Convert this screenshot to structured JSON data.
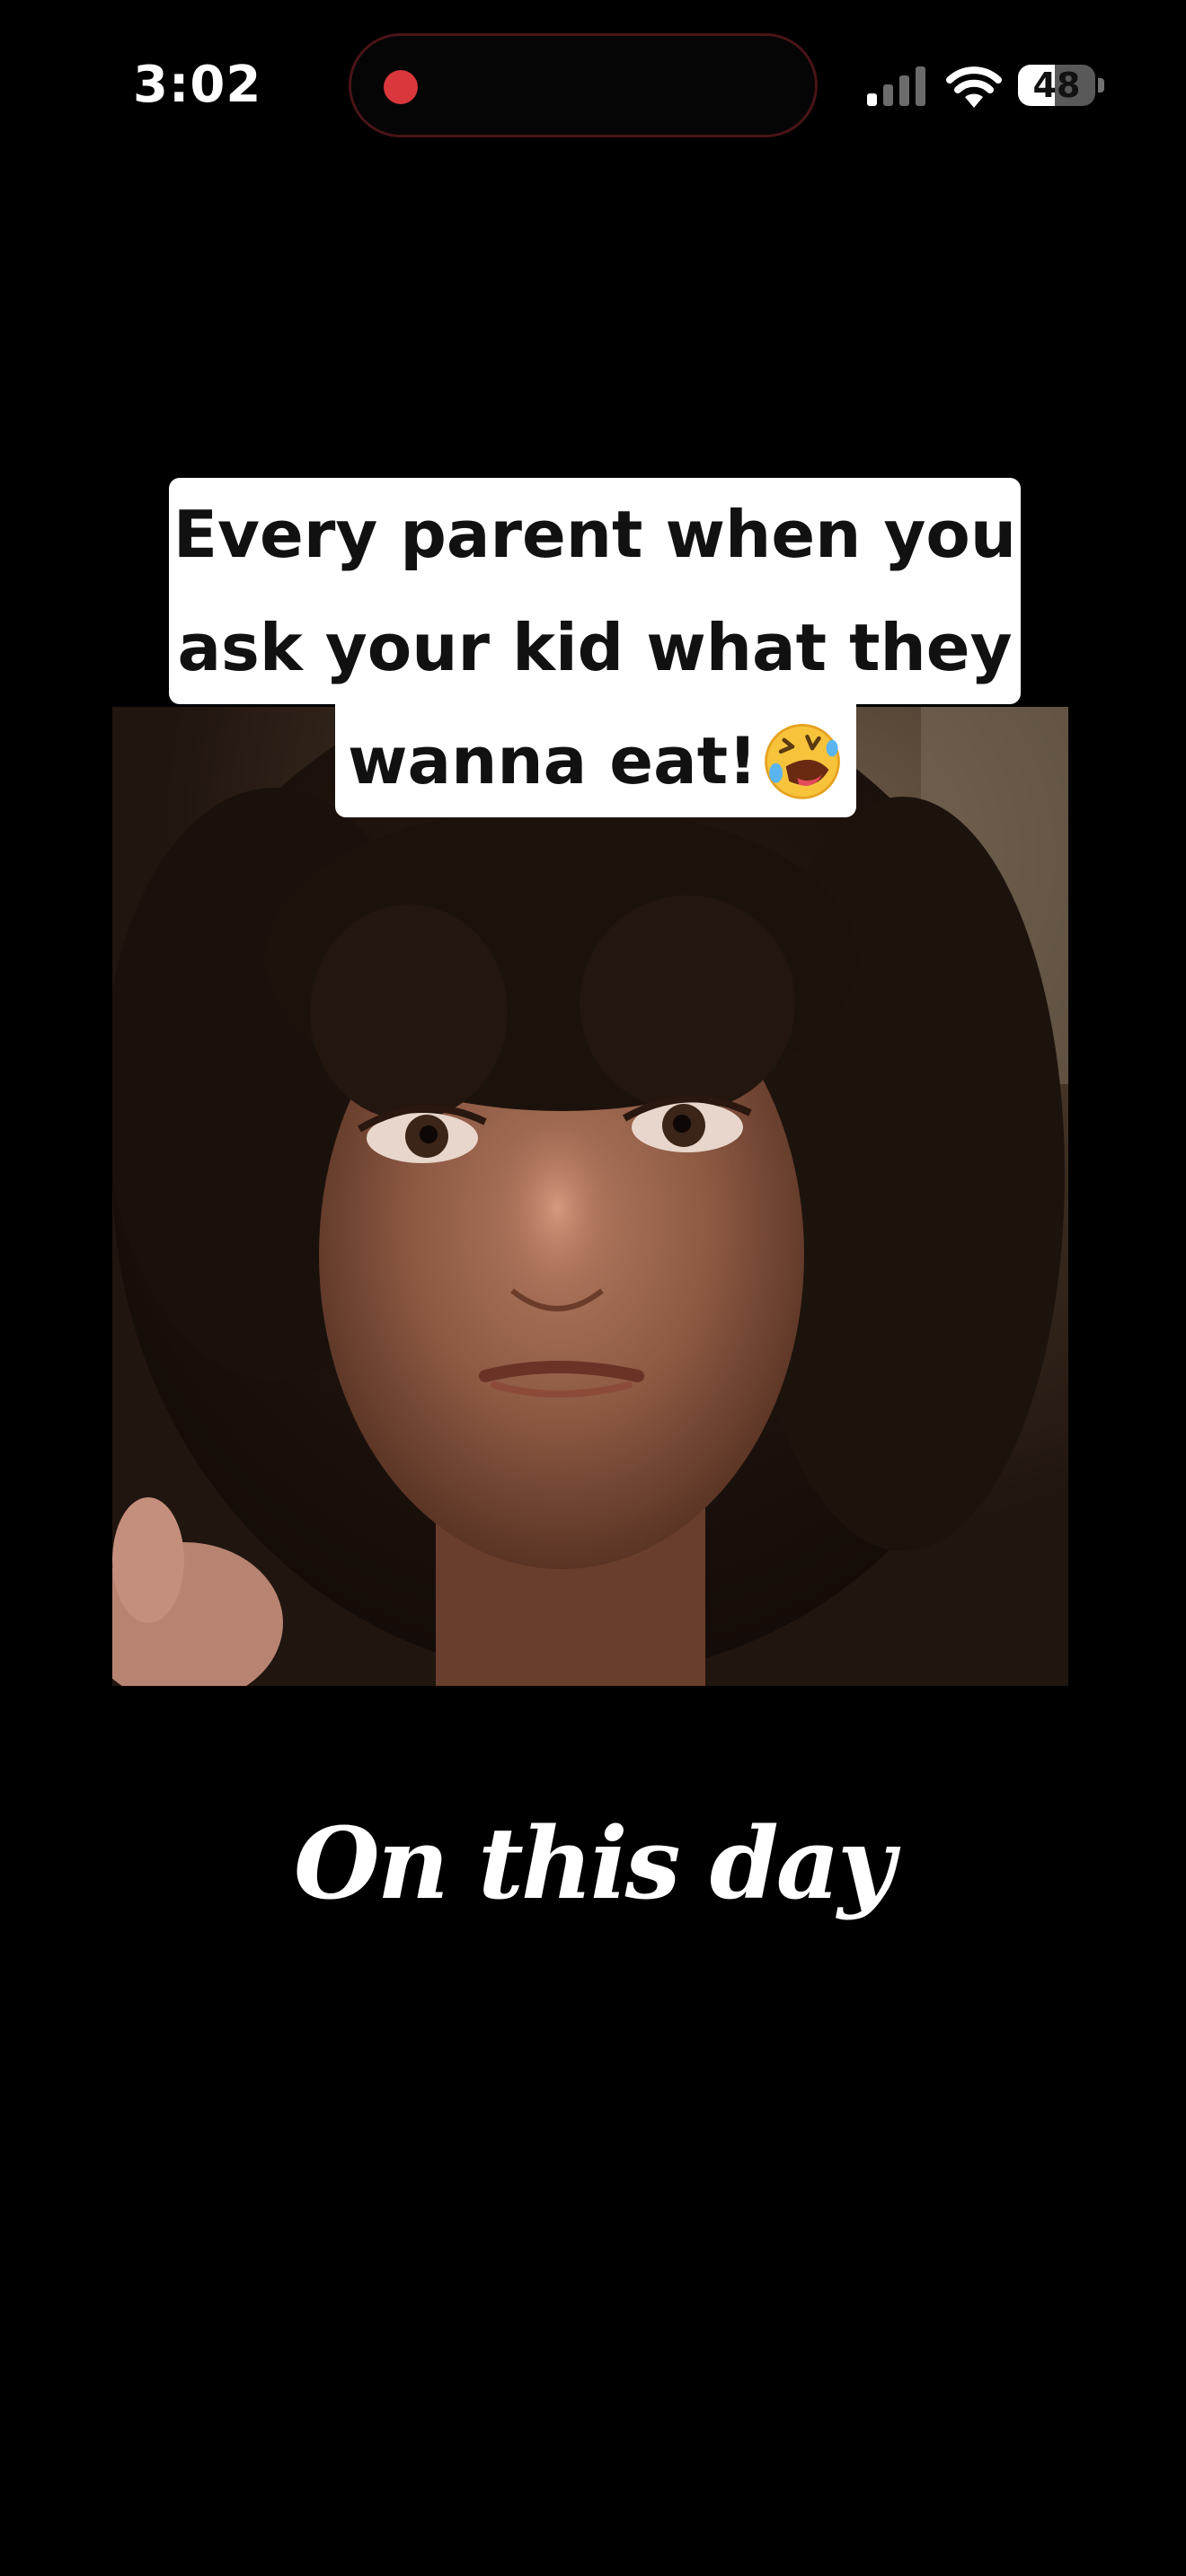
{
  "status_bar": {
    "time": "3:02",
    "battery_level": "48",
    "battery_fraction": 0.48,
    "recording_color": "#d9373c",
    "signal_icon": "cellular-signal-icon",
    "wifi_icon": "wifi-icon",
    "battery_icon": "battery-icon"
  },
  "video": {
    "caption_lines": [
      "Every parent when you",
      "ask your kid what they",
      "wanna eat!"
    ],
    "caption_emoji": "rolling-on-floor-laughing-emoji",
    "title": "On this day"
  }
}
